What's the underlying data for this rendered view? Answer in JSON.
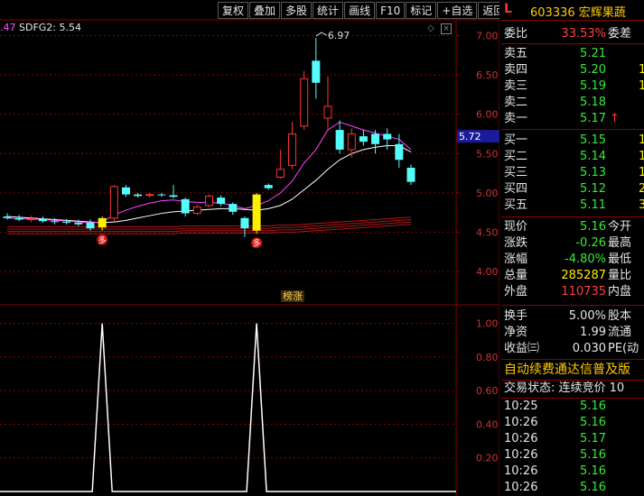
{
  "toolbar": [
    "复权",
    "叠加",
    "多股",
    "统计",
    "画线",
    "F10",
    "标记",
    "+自选",
    "返回"
  ],
  "indicator": {
    "left_value": ".47",
    "label": "SDFG2: 5.54"
  },
  "price_axis": [
    "7.00",
    "6.50",
    "6.00",
    "5.50",
    "5.00",
    "4.50",
    "4.00"
  ],
  "price_range": [
    3.6,
    7.2
  ],
  "current_price_label": "5.72",
  "peak_label": "6.97",
  "lower_axis": [
    "1.00",
    "0.80",
    "0.60",
    "0.40",
    "0.20"
  ],
  "lower_range": [
    0,
    1.1
  ],
  "signal_badges": [
    "多",
    "多"
  ],
  "tag_label": "榜涨",
  "colors": {
    "up": "#ff3232",
    "down": "#54fcfc",
    "ma_fast": "#ff44ff",
    "ma_slow": "#ffffff",
    "signal": "#ffee00",
    "grid": "#8b0000"
  },
  "chart_data": {
    "type": "candlestick",
    "candles": [
      {
        "o": 4.7,
        "h": 4.74,
        "l": 4.66,
        "c": 4.68
      },
      {
        "o": 4.68,
        "h": 4.72,
        "l": 4.64,
        "c": 4.66
      },
      {
        "o": 4.66,
        "h": 4.71,
        "l": 4.63,
        "c": 4.67
      },
      {
        "o": 4.67,
        "h": 4.7,
        "l": 4.62,
        "c": 4.64
      },
      {
        "o": 4.64,
        "h": 4.68,
        "l": 4.6,
        "c": 4.63
      },
      {
        "o": 4.63,
        "h": 4.67,
        "l": 4.6,
        "c": 4.62
      },
      {
        "o": 4.62,
        "h": 4.66,
        "l": 4.58,
        "c": 4.6
      },
      {
        "o": 4.62,
        "h": 4.66,
        "l": 4.52,
        "c": 4.55
      },
      {
        "o": 4.56,
        "h": 4.7,
        "l": 4.52,
        "c": 4.68,
        "signal": true
      },
      {
        "o": 4.68,
        "h": 5.1,
        "l": 4.64,
        "c": 5.08
      },
      {
        "o": 5.07,
        "h": 5.1,
        "l": 4.95,
        "c": 4.98
      },
      {
        "o": 4.98,
        "h": 5.0,
        "l": 4.94,
        "c": 4.96
      },
      {
        "o": 4.97,
        "h": 5.0,
        "l": 4.94,
        "c": 4.98
      },
      {
        "o": 4.98,
        "h": 5.0,
        "l": 4.95,
        "c": 4.97
      },
      {
        "o": 4.97,
        "h": 5.1,
        "l": 4.93,
        "c": 4.95
      },
      {
        "o": 4.92,
        "h": 4.94,
        "l": 4.7,
        "c": 4.74
      },
      {
        "o": 4.74,
        "h": 4.85,
        "l": 4.72,
        "c": 4.82
      },
      {
        "o": 4.84,
        "h": 4.98,
        "l": 4.82,
        "c": 4.96
      },
      {
        "o": 4.94,
        "h": 4.97,
        "l": 4.83,
        "c": 4.86
      },
      {
        "o": 4.86,
        "h": 4.88,
        "l": 4.72,
        "c": 4.76
      },
      {
        "o": 4.68,
        "h": 4.7,
        "l": 4.44,
        "c": 4.55
      },
      {
        "o": 4.52,
        "h": 5.0,
        "l": 4.48,
        "c": 4.98,
        "signal": true
      },
      {
        "o": 5.1,
        "h": 5.12,
        "l": 5.04,
        "c": 5.06
      },
      {
        "o": 5.2,
        "h": 5.55,
        "l": 5.18,
        "c": 5.3
      },
      {
        "o": 5.35,
        "h": 5.9,
        "l": 5.3,
        "c": 5.75
      },
      {
        "o": 5.85,
        "h": 6.55,
        "l": 5.8,
        "c": 6.45
      },
      {
        "o": 6.68,
        "h": 6.97,
        "l": 6.2,
        "c": 6.4
      },
      {
        "o": 5.95,
        "h": 6.48,
        "l": 5.8,
        "c": 6.1
      },
      {
        "o": 5.8,
        "h": 5.92,
        "l": 5.5,
        "c": 5.55
      },
      {
        "o": 5.55,
        "h": 5.82,
        "l": 5.45,
        "c": 5.75
      },
      {
        "o": 5.72,
        "h": 5.8,
        "l": 5.6,
        "c": 5.65
      },
      {
        "o": 5.75,
        "h": 5.8,
        "l": 5.5,
        "c": 5.62
      },
      {
        "o": 5.75,
        "h": 5.82,
        "l": 5.55,
        "c": 5.68
      },
      {
        "o": 5.62,
        "h": 5.75,
        "l": 5.32,
        "c": 5.42
      },
      {
        "o": 5.32,
        "h": 5.36,
        "l": 5.1,
        "c": 5.14
      }
    ],
    "ma_fast": [
      4.68,
      4.67,
      4.67,
      4.66,
      4.65,
      4.64,
      4.63,
      4.62,
      4.63,
      4.72,
      4.78,
      4.83,
      4.87,
      4.9,
      4.91,
      4.89,
      4.88,
      4.88,
      4.87,
      4.84,
      4.8,
      4.84,
      4.9,
      5.0,
      5.15,
      5.38,
      5.55,
      5.8,
      5.9,
      5.85,
      5.8,
      5.76,
      5.72,
      5.68,
      5.55
    ],
    "ma_slow": [
      4.7,
      4.69,
      4.68,
      4.67,
      4.66,
      4.65,
      4.64,
      4.63,
      4.62,
      4.63,
      4.65,
      4.68,
      4.71,
      4.74,
      4.76,
      4.77,
      4.78,
      4.79,
      4.8,
      4.8,
      4.79,
      4.78,
      4.8,
      4.84,
      4.92,
      5.04,
      5.16,
      5.3,
      5.42,
      5.5,
      5.55,
      5.58,
      5.6,
      5.6,
      5.52
    ],
    "bands": [
      [
        4.57,
        4.57,
        4.57,
        4.57,
        4.57,
        4.57,
        4.57,
        4.57,
        4.57,
        4.57,
        4.57,
        4.57,
        4.57,
        4.57,
        4.57,
        4.58,
        4.58,
        4.58,
        4.58,
        4.58,
        4.58,
        4.58,
        4.58,
        4.59,
        4.59,
        4.6,
        4.61,
        4.62,
        4.63,
        4.64,
        4.65,
        4.66,
        4.67,
        4.68,
        4.69
      ],
      [
        4.54,
        4.54,
        4.54,
        4.54,
        4.54,
        4.54,
        4.54,
        4.54,
        4.54,
        4.54,
        4.54,
        4.54,
        4.54,
        4.54,
        4.54,
        4.55,
        4.55,
        4.55,
        4.55,
        4.55,
        4.55,
        4.55,
        4.55,
        4.56,
        4.56,
        4.57,
        4.58,
        4.59,
        4.6,
        4.61,
        4.62,
        4.63,
        4.64,
        4.65,
        4.66
      ],
      [
        4.51,
        4.51,
        4.51,
        4.51,
        4.51,
        4.51,
        4.51,
        4.51,
        4.51,
        4.51,
        4.51,
        4.51,
        4.51,
        4.51,
        4.51,
        4.52,
        4.52,
        4.52,
        4.52,
        4.52,
        4.52,
        4.52,
        4.52,
        4.53,
        4.53,
        4.54,
        4.55,
        4.56,
        4.57,
        4.58,
        4.59,
        4.6,
        4.61,
        4.62,
        4.63
      ],
      [
        4.48,
        4.48,
        4.48,
        4.48,
        4.48,
        4.48,
        4.48,
        4.48,
        4.48,
        4.48,
        4.48,
        4.48,
        4.48,
        4.48,
        4.48,
        4.49,
        4.49,
        4.49,
        4.49,
        4.49,
        4.49,
        4.49,
        4.49,
        4.5,
        4.5,
        4.51,
        4.52,
        4.53,
        4.54,
        4.55,
        4.56,
        4.57,
        4.58,
        4.59,
        4.6
      ]
    ],
    "lower_signal": [
      0,
      0,
      0,
      0,
      0,
      0,
      0,
      0,
      1,
      0,
      0,
      0,
      0,
      0,
      0,
      0,
      0,
      0,
      0,
      0,
      0,
      1,
      0,
      0,
      0,
      0,
      0,
      0,
      0,
      0,
      0,
      0,
      0,
      0,
      0
    ]
  },
  "sidebar": {
    "tag": "L",
    "code": "603336",
    "name": "宏辉果蔬",
    "weibi": {
      "label": "委比",
      "value": "33.53%",
      "right": "委差"
    },
    "asks": [
      {
        "label": "卖五",
        "price": "5.21",
        "vol": ""
      },
      {
        "label": "卖四",
        "price": "5.20",
        "vol": "1"
      },
      {
        "label": "卖三",
        "price": "5.19",
        "vol": "1"
      },
      {
        "label": "卖二",
        "price": "5.18",
        "vol": ""
      },
      {
        "label": "卖一",
        "price": "5.17",
        "vol": "↑"
      }
    ],
    "bids": [
      {
        "label": "买一",
        "price": "5.15",
        "vol": "1"
      },
      {
        "label": "买二",
        "price": "5.14",
        "vol": "1"
      },
      {
        "label": "买三",
        "price": "5.13",
        "vol": "1"
      },
      {
        "label": "买四",
        "price": "5.12",
        "vol": "2"
      },
      {
        "label": "买五",
        "price": "5.11",
        "vol": "3"
      }
    ],
    "quote": [
      {
        "label": "现价",
        "value": "5.16",
        "right": "今开",
        "cls": "green"
      },
      {
        "label": "涨跌",
        "value": "-0.26",
        "right": "最高",
        "cls": "green"
      },
      {
        "label": "涨幅",
        "value": "-4.80%",
        "right": "最低",
        "cls": "green"
      },
      {
        "label": "总量",
        "value": "285287",
        "right": "量比",
        "cls": "yellow"
      },
      {
        "label": "外盘",
        "value": "110735",
        "right": "内盘",
        "cls": "red"
      }
    ],
    "fundamentals": [
      {
        "label": "换手",
        "value": "5.00%",
        "right": "股本"
      },
      {
        "label": "净资",
        "value": "1.99",
        "right": "流通"
      },
      {
        "label": "收益㈢",
        "value": "0.030",
        "right": "PE(动"
      }
    ],
    "notice": "自动续费通达信普及版",
    "status": "交易状态: 连续竞价 10",
    "ticks": [
      {
        "time": "10:25",
        "price": "5.16"
      },
      {
        "time": "10:26",
        "price": "5.16"
      },
      {
        "time": "10:26",
        "price": "5.17"
      },
      {
        "time": "10:26",
        "price": "5.16"
      },
      {
        "time": "10:26",
        "price": "5.16"
      },
      {
        "time": "10:26",
        "price": "5.16"
      }
    ]
  }
}
